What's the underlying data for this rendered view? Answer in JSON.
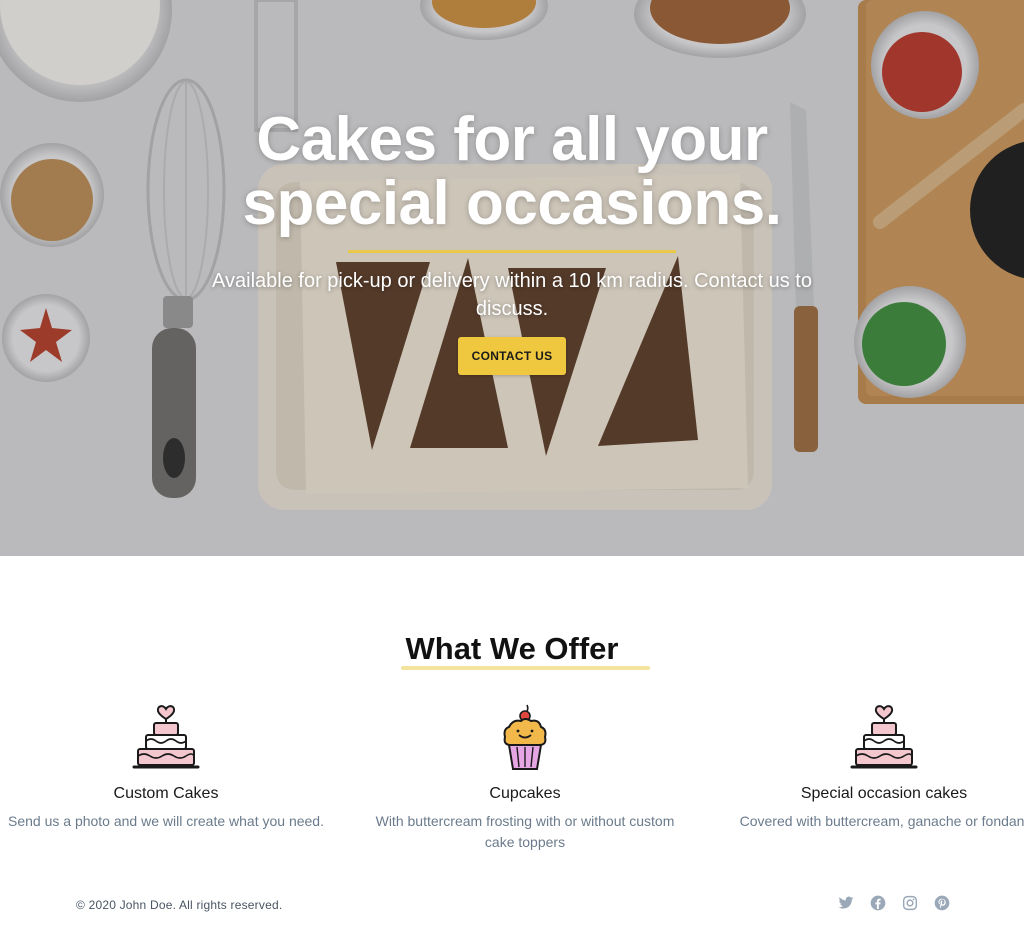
{
  "hero": {
    "title": "Cakes for all your special occasions.",
    "subtitle": "Available for pick-up or delivery within a 10 km radius. Contact us to discuss.",
    "cta_label": "CONTACT US",
    "accent_color": "#efc83f"
  },
  "offer": {
    "heading": "What We Offer",
    "items": [
      {
        "icon": "tiered-cake-icon",
        "title": "Custom Cakes",
        "description": "Send us a photo and we will create what you need."
      },
      {
        "icon": "cupcake-icon",
        "title": "Cupcakes",
        "description": "With buttercream frosting with or without custom cake toppers"
      },
      {
        "icon": "tiered-cake-icon",
        "title": "Special occasion cakes",
        "description": "Covered with buttercream, ganache or fondant"
      }
    ]
  },
  "footer": {
    "copyright": "© 2020 John Doe. All rights reserved.",
    "socials": [
      "twitter-icon",
      "facebook-icon",
      "instagram-icon",
      "pinterest-icon"
    ]
  }
}
